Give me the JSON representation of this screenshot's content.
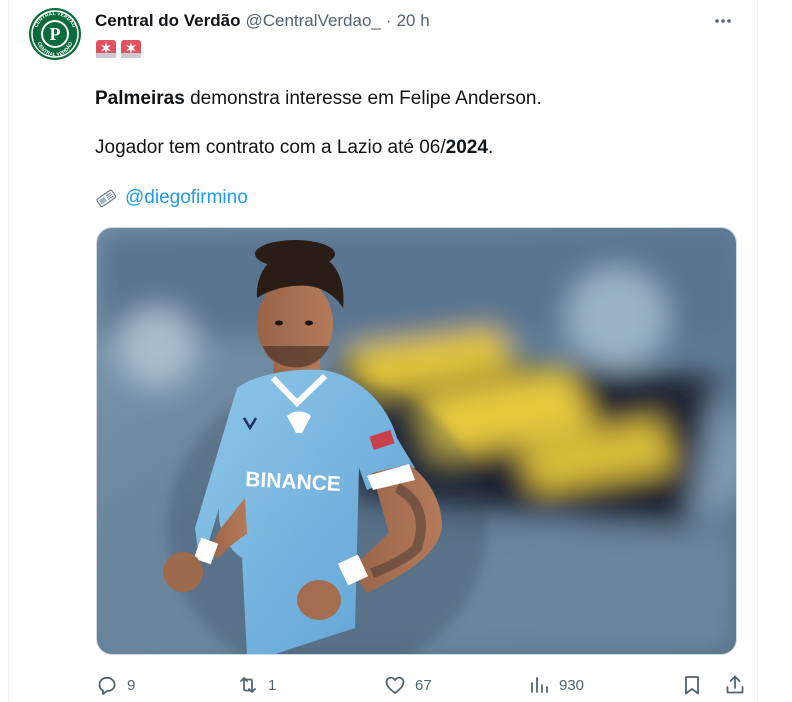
{
  "tweet": {
    "display_name": "Central do Verdão",
    "handle": "@CentralVerdao_",
    "separator": "·",
    "time": "20 h",
    "avatar_top_text": "CENTRAL VERDÃO",
    "avatar_letter": "P",
    "avatar_bottom_text": "CENTRAL VERDÃO",
    "text_line1_bold": "Palmeiras",
    "text_line1_rest": " demonstra interesse em Felipe Anderson.",
    "text_line2_start": "Jogador tem contrato com a Lazio até 06/",
    "text_line2_bold": "2024",
    "text_line2_end": ".",
    "credit_icon": "newspaper-icon",
    "mention": "@diegofirmino",
    "media": {
      "shirt_sponsor": "BINANCE"
    }
  },
  "actions": {
    "replies": "9",
    "retweets": "1",
    "likes": "67",
    "views": "930"
  },
  "colors": {
    "accent": "#1d9bf0",
    "muted": "#536471",
    "avatar_green": "#0b6b3a"
  }
}
